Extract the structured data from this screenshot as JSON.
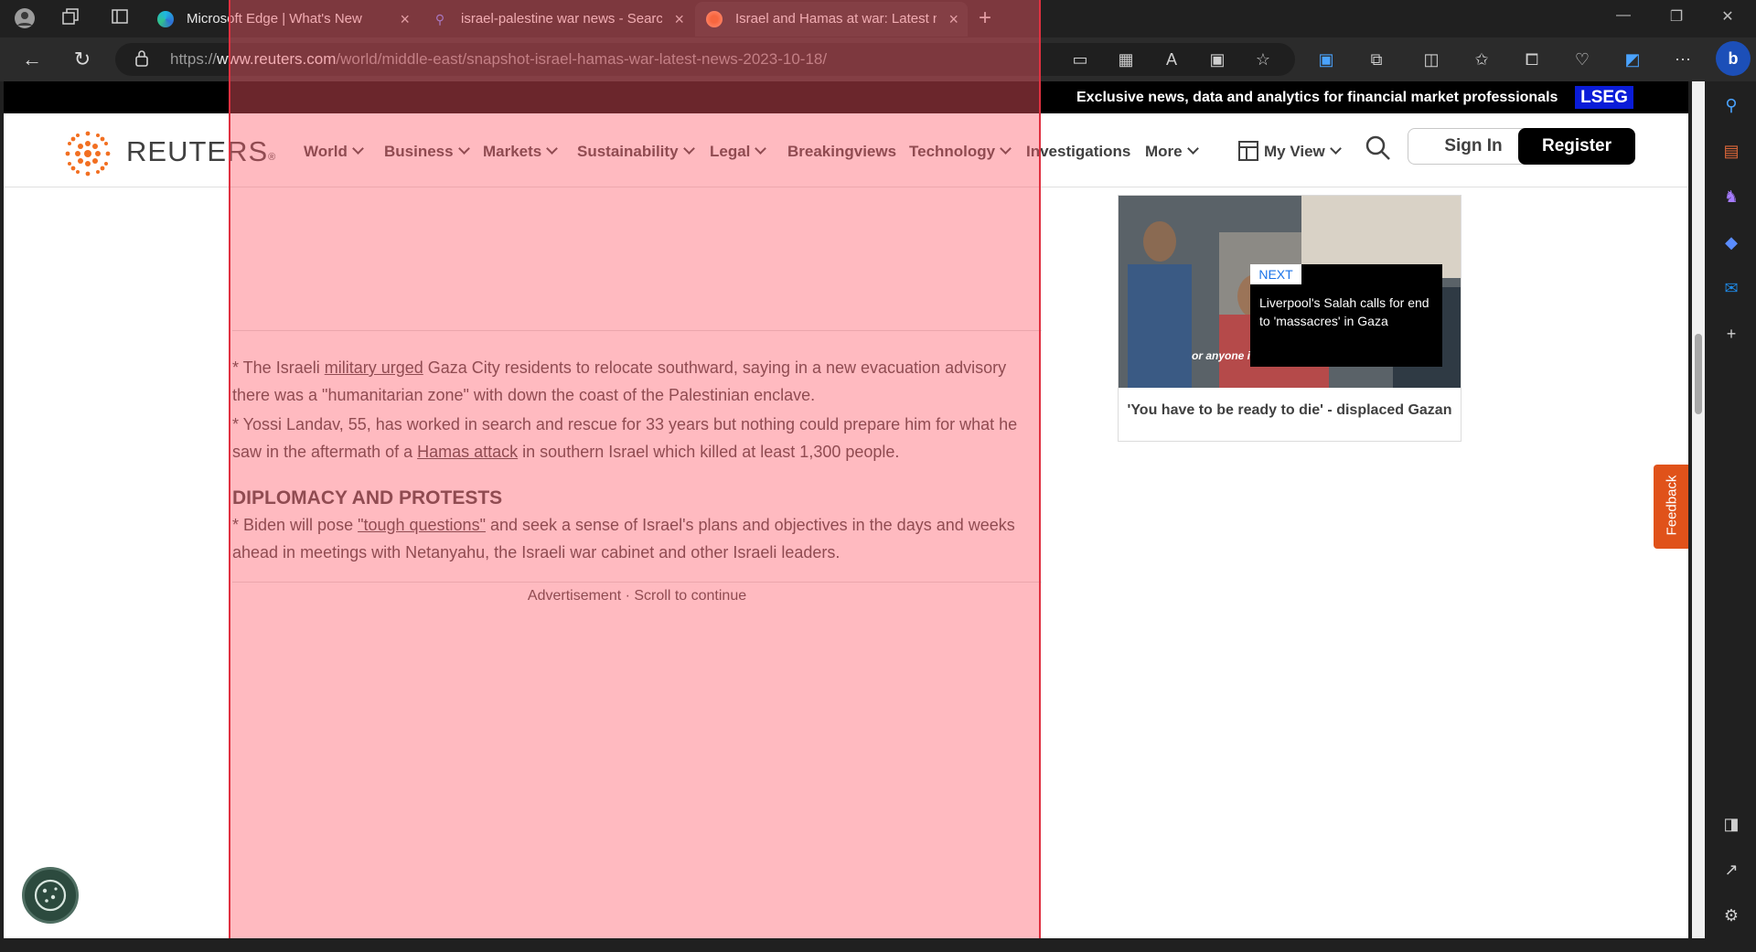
{
  "browser": {
    "tabs": [
      {
        "label": "Microsoft Edge | What's New",
        "icon": "edge-icon"
      },
      {
        "label": "israel-palestine war news - Search",
        "icon": "search-icon"
      },
      {
        "label": "Israel and Hamas at war: Latest news",
        "icon": "reuters-icon"
      }
    ],
    "url": {
      "scheme": "https://",
      "host": "www.reuters.com",
      "path": "/world/middle-east/snapshot-israel-hamas-war-latest-news-2023-10-18/"
    },
    "new_tab_symbol": "+",
    "close_symbol": "×"
  },
  "banner": {
    "text": "Exclusive news, data and analytics for financial market professionals",
    "brand": "LSEG"
  },
  "nav": {
    "logo": "REUTERS",
    "items": [
      "World",
      "Business",
      "Markets",
      "Sustainability",
      "Legal",
      "Breakingviews",
      "Technology",
      "Investigations",
      "More"
    ],
    "my_view": "My View",
    "sign_in": "Sign In",
    "register": "Register"
  },
  "article": {
    "p1": {
      "before": "* The Israeli ",
      "link": "military urged",
      "after": " Gaza City residents to relocate southward, saying in a new evacuation advisory there was a \"humanitarian zone\" with down the coast of the Palestinian enclave."
    },
    "p2": {
      "before": "* Yossi Landav, 55, has worked in search and rescue for 33 years but nothing could prepare him for what he saw in the aftermath of a ",
      "link": "Hamas attack",
      "after": " in southern Israel which killed at least 1,300 people."
    },
    "heading": "DIPLOMACY AND PROTESTS",
    "p3": {
      "before": "* Biden will pose ",
      "link": "\"tough questions\"",
      "after": " and seek a sense of Israel's plans and objectives in the days and weeks ahead in meetings with Netanyahu, the Israeli war cabinet and other Israeli leaders."
    },
    "ad_text": "Advertisement · Scroll to continue"
  },
  "video": {
    "next_label": "NEXT",
    "next_title": "Liverpool's Salah calls for end to 'massacres' in Gaza",
    "watermark": "or anyone i",
    "caption": "'You have to be ready to die' - displaced Gazan"
  },
  "feedback": "Feedback",
  "colors": {
    "reuters_orange": "#f26f21",
    "lseg_blue": "#0a1cd8",
    "highlight": "#ff5a69"
  }
}
